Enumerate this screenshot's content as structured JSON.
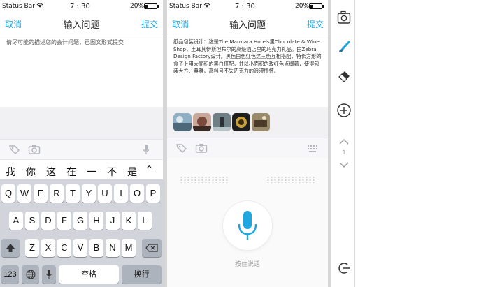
{
  "status_bar": {
    "carrier": "Status Bar",
    "time": "7 : 30",
    "battery": "20%"
  },
  "nav": {
    "cancel": "取消",
    "title": "输入问题",
    "submit": "提交"
  },
  "panel1": {
    "placeholder": "请尽可能的描述您的会计问题，已图文形式提交",
    "candidates": [
      "我",
      "你",
      "这",
      "在",
      "一",
      "不",
      "是",
      "^"
    ],
    "keyboard": {
      "row1": [
        "Q",
        "W",
        "E",
        "R",
        "T",
        "Y",
        "U",
        "I",
        "O",
        "P"
      ],
      "row2": [
        "A",
        "S",
        "D",
        "F",
        "G",
        "H",
        "J",
        "K",
        "L"
      ],
      "row3": [
        "Z",
        "X",
        "C",
        "V",
        "B",
        "N",
        "M"
      ],
      "numbers": "123",
      "space": "空格",
      "return": "换行"
    }
  },
  "panel2": {
    "body_text": "纸品包装设计：这是The Marmara Hotels里Chocolate & Wine Shop，土耳其伊斯坦布尔的高级酒店里的巧克力礼品。由Zebra Design Factory设计。黑色白色红色这三色互相搭配，特长方形的盒子上用大面积的黑白搭配，并以小面积的玫红色点缀着，使得包装大方、典雅，高档且不失巧克力的浪漫情怀。",
    "voice_hint": "按住说话",
    "accent": "#1fa8e0"
  },
  "rail": {
    "icons": [
      "camera-icon",
      "brush-icon",
      "eraser-icon",
      "add-circle-icon",
      "chevron-up-icon",
      "chevron-down-icon",
      "exit-icon"
    ],
    "page_indicator": "1"
  }
}
